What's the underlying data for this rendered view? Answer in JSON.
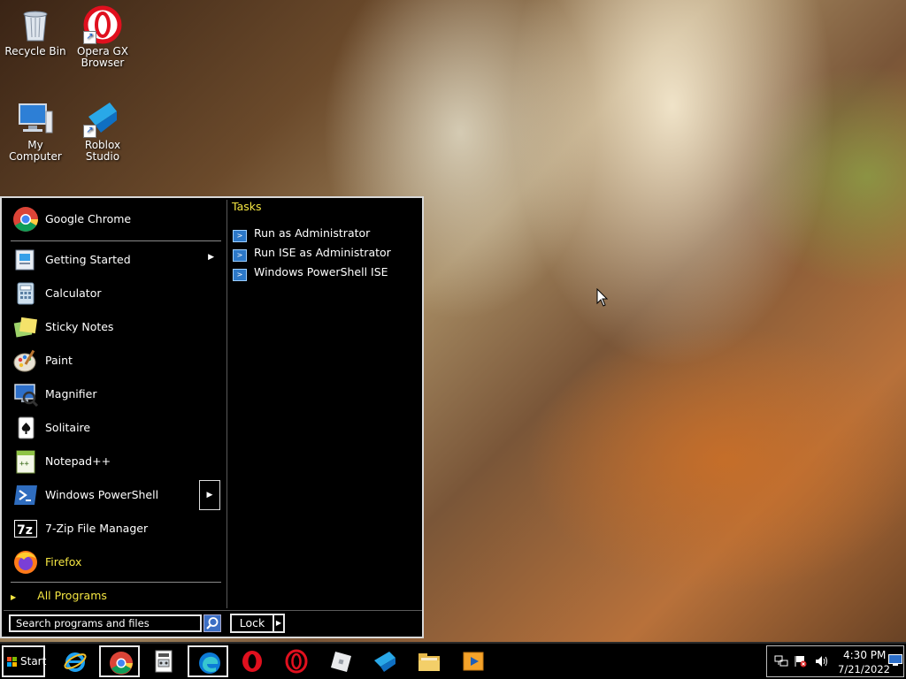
{
  "desktop": {
    "icons": [
      {
        "label": "Recycle Bin",
        "icon": "recycle-bin-icon"
      },
      {
        "label": "Opera GX Browser",
        "icon": "opera-gx-icon"
      },
      {
        "label": "My Computer",
        "icon": "computer-icon"
      },
      {
        "label": "Roblox Studio",
        "icon": "roblox-studio-icon"
      }
    ]
  },
  "start_menu": {
    "pinned": [
      {
        "label": "Google Chrome",
        "icon": "chrome-icon"
      }
    ],
    "programs": [
      {
        "label": "Getting Started",
        "icon": "getting-started-icon",
        "has_submenu": true
      },
      {
        "label": "Calculator",
        "icon": "calculator-icon"
      },
      {
        "label": "Sticky Notes",
        "icon": "sticky-notes-icon"
      },
      {
        "label": "Paint",
        "icon": "paint-icon"
      },
      {
        "label": "Magnifier",
        "icon": "magnifier-icon"
      },
      {
        "label": "Solitaire",
        "icon": "solitaire-icon"
      },
      {
        "label": "Notepad++",
        "icon": "notepad-plus-plus-icon"
      },
      {
        "label": "Windows PowerShell",
        "icon": "powershell-icon",
        "has_submenu": true,
        "selected": true
      },
      {
        "label": "7-Zip File Manager",
        "icon": "7zip-icon"
      },
      {
        "label": "Firefox",
        "icon": "firefox-icon"
      }
    ],
    "all_programs": "All Programs",
    "tasks_title": "Tasks",
    "tasks": [
      "Run as Administrator",
      "Run ISE as Administrator",
      "Windows PowerShell ISE"
    ],
    "search_placeholder": "Search programs and files",
    "lock_label": "Lock"
  },
  "taskbar": {
    "start_label": "Start",
    "apps": [
      {
        "name": "Internet Explorer",
        "icon": "internet-explorer-icon"
      },
      {
        "name": "Google Chrome",
        "icon": "chrome-icon",
        "active": true
      },
      {
        "name": "Control Panel",
        "icon": "control-panel-icon"
      },
      {
        "name": "Microsoft Edge",
        "icon": "edge-icon",
        "active": true
      },
      {
        "name": "Opera",
        "icon": "opera-icon"
      },
      {
        "name": "Opera GX",
        "icon": "opera-gx-icon"
      },
      {
        "name": "Roblox",
        "icon": "roblox-icon"
      },
      {
        "name": "Roblox Studio",
        "icon": "roblox-studio-icon"
      },
      {
        "name": "File Explorer",
        "icon": "file-explorer-icon"
      },
      {
        "name": "Media Player",
        "icon": "media-player-icon"
      }
    ],
    "tray": {
      "time": "4:30 PM",
      "date": "7/21/2022",
      "icons": [
        "network-icon",
        "action-center-icon",
        "volume-icon",
        "show-desktop-icon"
      ]
    }
  },
  "colors": {
    "menu_bg": "#000000",
    "highlight_text": "#f5e642",
    "taskbar_bg": "#000000"
  }
}
